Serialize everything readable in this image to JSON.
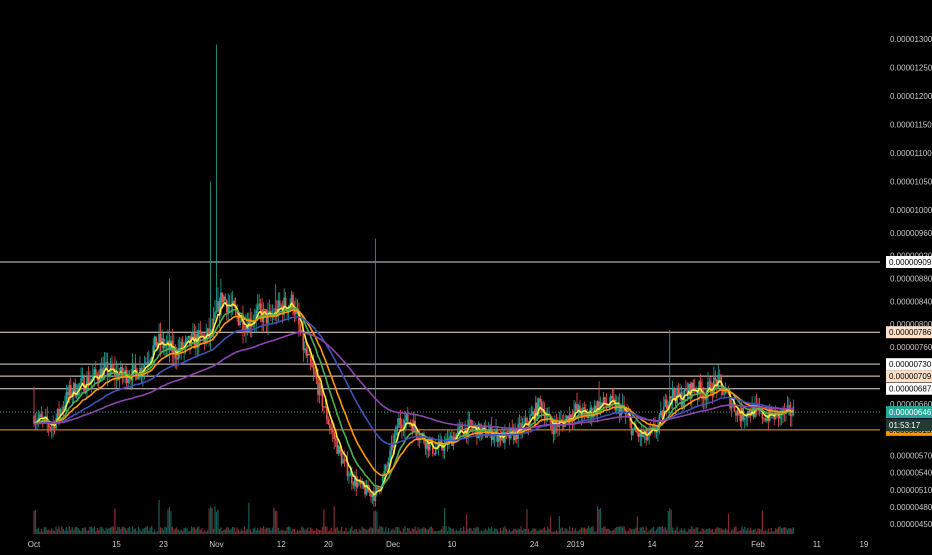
{
  "chart_data": {
    "type": "candlestick",
    "title": "",
    "xlabel": "",
    "ylabel": "",
    "background": "#000000",
    "grid": false,
    "ylim": [
      4.36e-06,
      1.34e-05
    ],
    "y_ticks": [
      "0.00001300",
      "0.00001250",
      "0.00001200",
      "0.00001150",
      "0.00001100",
      "0.00001050",
      "0.00001000",
      "0.00000960",
      "0.00000920",
      "0.00000880",
      "0.00000840",
      "0.00000800",
      "0.00000760",
      "0.00000660",
      "0.00000570",
      "0.00000540",
      "0.00000510",
      "0.00000480",
      "0.00000450"
    ],
    "y_tick_values": [
      1.3e-05,
      1.25e-05,
      1.2e-05,
      1.15e-05,
      1.1e-05,
      1.05e-05,
      1e-05,
      9.6e-06,
      9.2e-06,
      8.8e-06,
      8.4e-06,
      8e-06,
      7.6e-06,
      6.6e-06,
      5.7e-06,
      5.4e-06,
      5.1e-06,
      4.8e-06,
      4.5e-06
    ],
    "x_ticks": [
      "Oct",
      "15",
      "23",
      "Nov",
      "12",
      "20",
      "Dec",
      "10",
      "24",
      "2019",
      "14",
      "22",
      "Feb",
      "11",
      "19"
    ],
    "x_tick_days": [
      0,
      14,
      22,
      31,
      42,
      50,
      61,
      71,
      85,
      92,
      105,
      113,
      123,
      133,
      141
    ],
    "days_total": 150,
    "last_data_day": 129,
    "anchors": [
      [
        0,
        6.4e-06
      ],
      [
        3,
        6.2e-06
      ],
      [
        6,
        6.8e-06
      ],
      [
        9,
        7e-06
      ],
      [
        12,
        7.2e-06
      ],
      [
        15,
        7.1e-06
      ],
      [
        18,
        7.2e-06
      ],
      [
        21,
        7.7e-06
      ],
      [
        24,
        7.5e-06
      ],
      [
        27,
        7.7e-06
      ],
      [
        30,
        7.8e-06
      ],
      [
        32,
        8.5e-06
      ],
      [
        34,
        8.2e-06
      ],
      [
        36,
        8e-06
      ],
      [
        38,
        8.2e-06
      ],
      [
        40,
        8.1e-06
      ],
      [
        42,
        8.3e-06
      ],
      [
        44,
        8.4e-06
      ],
      [
        46,
        7.5e-06
      ],
      [
        48,
        7e-06
      ],
      [
        50,
        6.3e-06
      ],
      [
        52,
        5.7e-06
      ],
      [
        54,
        5.3e-06
      ],
      [
        56,
        5.1e-06
      ],
      [
        58,
        5e-06
      ],
      [
        60,
        5.5e-06
      ],
      [
        62,
        6.3e-06
      ],
      [
        64,
        6.3e-06
      ],
      [
        66,
        6e-06
      ],
      [
        68,
        5.8e-06
      ],
      [
        70,
        5.9e-06
      ],
      [
        72,
        6.1e-06
      ],
      [
        74,
        6.2e-06
      ],
      [
        76,
        6.1e-06
      ],
      [
        78,
        6.1e-06
      ],
      [
        80,
        6e-06
      ],
      [
        82,
        6.1e-06
      ],
      [
        84,
        6.3e-06
      ],
      [
        86,
        6.6e-06
      ],
      [
        88,
        6.2e-06
      ],
      [
        90,
        6.3e-06
      ],
      [
        92,
        6.5e-06
      ],
      [
        94,
        6.4e-06
      ],
      [
        96,
        6.6e-06
      ],
      [
        98,
        6.6e-06
      ],
      [
        100,
        6.5e-06
      ],
      [
        102,
        6.1e-06
      ],
      [
        104,
        6e-06
      ],
      [
        106,
        6.2e-06
      ],
      [
        108,
        6.8e-06
      ],
      [
        110,
        6.7e-06
      ],
      [
        112,
        6.9e-06
      ],
      [
        114,
        6.8e-06
      ],
      [
        116,
        7e-06
      ],
      [
        118,
        6.7e-06
      ],
      [
        120,
        6.4e-06
      ],
      [
        122,
        6.5e-06
      ],
      [
        124,
        6.4e-06
      ],
      [
        126,
        6.4e-06
      ],
      [
        129,
        6.46e-06
      ]
    ],
    "spikes": [
      [
        31,
        1.29e-05
      ],
      [
        30,
        1.05e-05
      ],
      [
        58,
        9.5e-06
      ],
      [
        23,
        8.8e-06
      ],
      [
        41,
        8.7e-06
      ],
      [
        108,
        7.9e-06
      ],
      [
        96,
        7e-06
      ],
      [
        0,
        6.9e-06
      ]
    ],
    "series": [
      {
        "name": "",
        "color": "#ffeb3b",
        "period": 3
      },
      {
        "name": "",
        "color": "#4caf50",
        "period": 8
      },
      {
        "name": "",
        "color": "#ff9800",
        "period": 14
      },
      {
        "name": "",
        "color": "#3f51b5",
        "period": 30
      },
      {
        "name": "",
        "color": "#8e44ad",
        "period": 60
      }
    ],
    "horizontal_levels": [
      {
        "value": 9.09e-06,
        "label": "0.00000909",
        "line_color": "#d8d8d8",
        "label_bg": "#ffffff",
        "label_fg": "#000000"
      },
      {
        "value": 7.86e-06,
        "label": "0.00000786",
        "line_color": "#ffe0c8",
        "label_bg": "#ffe0c8",
        "label_fg": "#000000"
      },
      {
        "value": 7.3e-06,
        "label": "0.00000730",
        "line_color": "#d8d8d8",
        "label_bg": "#ffffff",
        "label_fg": "#000000"
      },
      {
        "value": 7.09e-06,
        "label": "0.00000709",
        "line_color": "#ffe0c8",
        "label_bg": "#ffe0c8",
        "label_fg": "#000000"
      },
      {
        "value": 6.87e-06,
        "label": "0.00000687",
        "line_color": "#d8d8d8",
        "label_bg": "#ffffff",
        "label_fg": "#000000"
      },
      {
        "value": 6.15e-06,
        "label": "0.00000615",
        "line_color": "#ff9800",
        "label_bg": "#ff9800",
        "label_fg": "#000000"
      }
    ],
    "current_price": {
      "value": 6.46e-06,
      "label": "0.00000646",
      "countdown": "01:53:17",
      "color": "#26a69a"
    },
    "colors": {
      "up": "#26a69a",
      "down": "#ef5350",
      "axis_text": "#c8c8c8"
    }
  }
}
